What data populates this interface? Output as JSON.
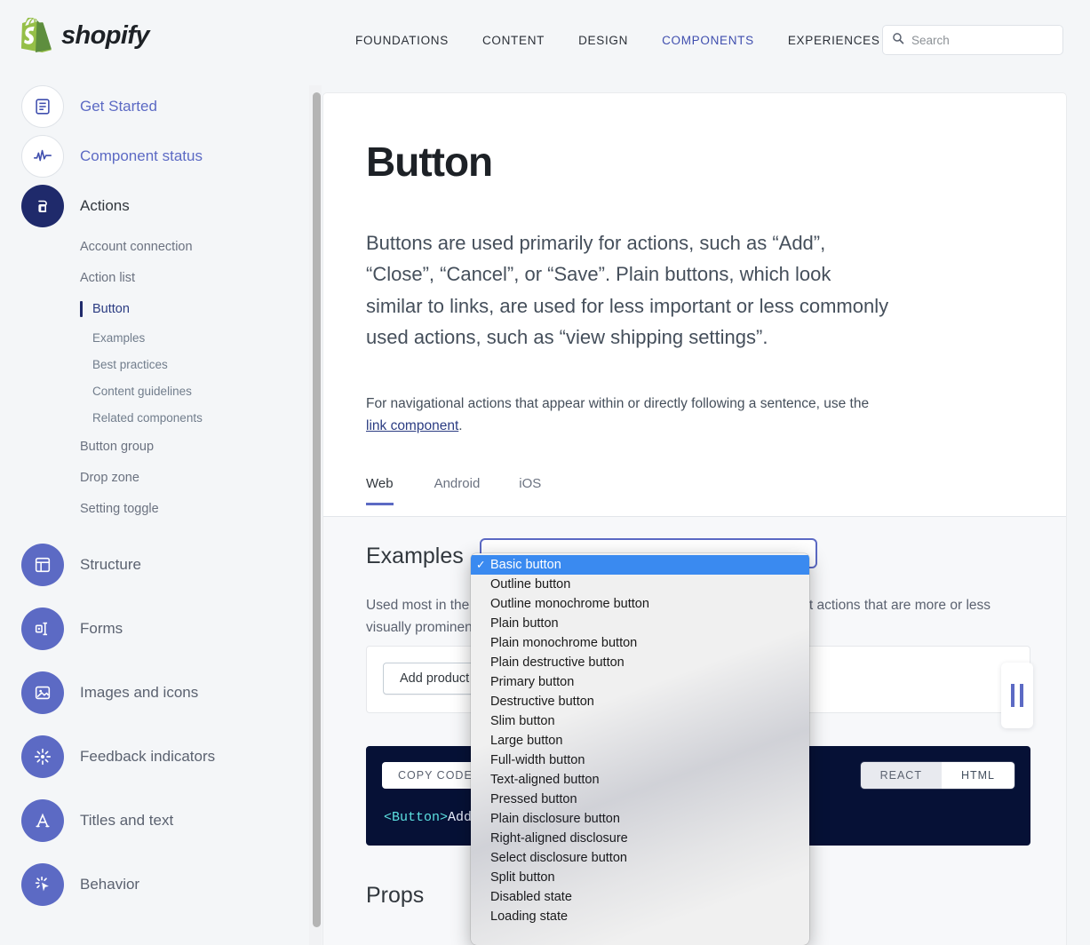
{
  "brand": {
    "name": "shopify",
    "logo_icon": "shopify-bag-logo",
    "green": "#95BF47",
    "green_dark": "#5E8E3E"
  },
  "topnav": {
    "items": [
      {
        "label": "FOUNDATIONS",
        "active": false
      },
      {
        "label": "CONTENT",
        "active": false
      },
      {
        "label": "DESIGN",
        "active": false
      },
      {
        "label": "COMPONENTS",
        "active": true
      },
      {
        "label": "EXPERIENCES",
        "active": false
      }
    ],
    "active_color": "#3f4eae"
  },
  "search": {
    "placeholder": "Search",
    "value": "",
    "icon": "search-icon"
  },
  "sidebar": {
    "groups": [
      {
        "label": "Get Started",
        "icon": "document-lines-icon",
        "style": "hollow",
        "label_style": "link"
      },
      {
        "label": "Component status",
        "icon": "pulse-wave-icon",
        "style": "hollow",
        "label_style": "link"
      },
      {
        "label": "Actions",
        "icon": "actions-cursor-icon",
        "style": "navy",
        "label_style": "dark"
      }
    ],
    "actions_items": [
      {
        "label": "Account connection",
        "active": false
      },
      {
        "label": "Action list",
        "active": false
      },
      {
        "label": "Button",
        "active": true
      },
      {
        "label": "Button group",
        "active": false
      },
      {
        "label": "Drop zone",
        "active": false
      },
      {
        "label": "Setting toggle",
        "active": false
      }
    ],
    "button_subitems": [
      {
        "label": "Examples"
      },
      {
        "label": "Best practices"
      },
      {
        "label": "Content guidelines"
      },
      {
        "label": "Related components"
      }
    ],
    "lower_groups": [
      {
        "label": "Structure",
        "icon": "layout-panel-icon",
        "style": "purple"
      },
      {
        "label": "Forms",
        "icon": "form-field-icon",
        "style": "purple"
      },
      {
        "label": "Images and icons",
        "icon": "image-icon",
        "style": "purple"
      },
      {
        "label": "Feedback indicators",
        "icon": "spinner-burst-icon",
        "style": "purple"
      },
      {
        "label": "Titles and text",
        "icon": "letter-a-icon",
        "style": "purple"
      },
      {
        "label": "Behavior",
        "icon": "click-burst-icon",
        "style": "purple"
      }
    ],
    "accent": "#5c6ac4",
    "navy": "#1f2a6b"
  },
  "main": {
    "title": "Button",
    "lead": "Buttons are used primarily for actions, such as “Add”, “Close”, “Cancel”, or “Save”. Plain buttons, which look similar to links, are used for less important or less commonly used actions, such as “view shipping settings”.",
    "sub_before": "For navigational actions that appear within or directly following a sentence, use the ",
    "sub_link": "link component",
    "sub_after": ".",
    "platform_tabs": [
      {
        "label": "Web",
        "active": true
      },
      {
        "label": "Android",
        "active": false
      },
      {
        "label": "iOS",
        "active": false
      }
    ],
    "examples_heading": "Examples",
    "examples_desc": "Used most in the interface, secondary buttons are used for less important actions that are more or less visually prominent depending on the actions around them",
    "preview_button_label": "Add product",
    "pause_icon": "pause-icon",
    "copy_code_label": "COPY CODE",
    "code_tag": "<Button>",
    "code_rest": "Add product</Button>",
    "lang_toggle": [
      {
        "label": "REACT",
        "active": false
      },
      {
        "label": "HTML",
        "active": true
      }
    ],
    "props_heading": "Props",
    "select_value": "Basic button"
  },
  "dropdown": {
    "options": [
      {
        "label": "Basic button",
        "selected": true
      },
      {
        "label": "Outline button",
        "selected": false
      },
      {
        "label": "Outline monochrome button",
        "selected": false
      },
      {
        "label": "Plain button",
        "selected": false
      },
      {
        "label": "Plain monochrome button",
        "selected": false
      },
      {
        "label": "Plain destructive button",
        "selected": false
      },
      {
        "label": "Primary button",
        "selected": false
      },
      {
        "label": "Destructive button",
        "selected": false
      },
      {
        "label": "Slim button",
        "selected": false
      },
      {
        "label": "Large button",
        "selected": false
      },
      {
        "label": "Full-width button",
        "selected": false
      },
      {
        "label": "Text-aligned button",
        "selected": false
      },
      {
        "label": "Pressed button",
        "selected": false
      },
      {
        "label": "Plain disclosure button",
        "selected": false
      },
      {
        "label": "Right-aligned disclosure",
        "selected": false
      },
      {
        "label": "Select disclosure button",
        "selected": false
      },
      {
        "label": "Split button",
        "selected": false
      },
      {
        "label": "Disabled state",
        "selected": false
      },
      {
        "label": "Loading state",
        "selected": false
      }
    ],
    "highlight_color": "#3a8af0",
    "check_glyph": "✓"
  }
}
